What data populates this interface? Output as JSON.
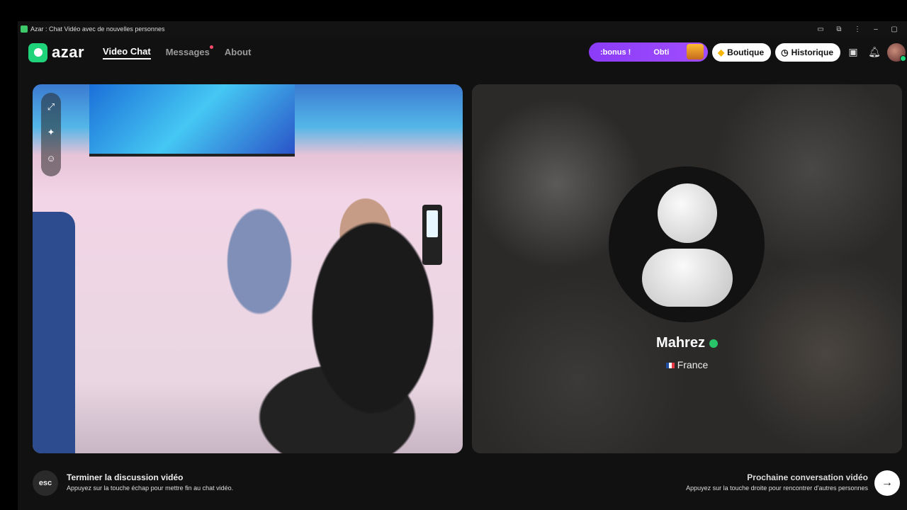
{
  "window": {
    "title": "Azar : Chat Vidéo avec de nouvelles personnes"
  },
  "navbar": {
    "logo_text": "azar",
    "tabs": [
      {
        "label": "Video Chat",
        "active": true
      },
      {
        "label": "Messages",
        "active": false,
        "notification_dot": true
      },
      {
        "label": "About",
        "active": false
      }
    ],
    "promo": {
      "part1": ":bonus !",
      "part2": "Obti"
    },
    "boutique_label": "Boutique",
    "historique_label": "Historique"
  },
  "remote_user": {
    "name": "Mahrez",
    "country": "France",
    "verified": true
  },
  "footer": {
    "esc_label": "esc",
    "end_title": "Terminer la discussion vidéo",
    "end_desc": "Appuyez sur la touche échap pour mettre fin au chat vidéo.",
    "next_title": "Prochaine conversation vidéo",
    "next_desc": "Appuyez sur la touche droite pour rencontrer d'autres personnes"
  },
  "colors": {
    "brand_green": "#1fd37a",
    "promo_purple": "#8b3cf7"
  },
  "icons": {
    "expand": "expand-icon",
    "magic": "magic-wand-icon",
    "sticker": "sticker-icon",
    "gem": "gem-icon",
    "clock": "clock-icon",
    "store": "store-icon",
    "bell": "bell-icon",
    "arrow": "arrow-right-icon"
  }
}
